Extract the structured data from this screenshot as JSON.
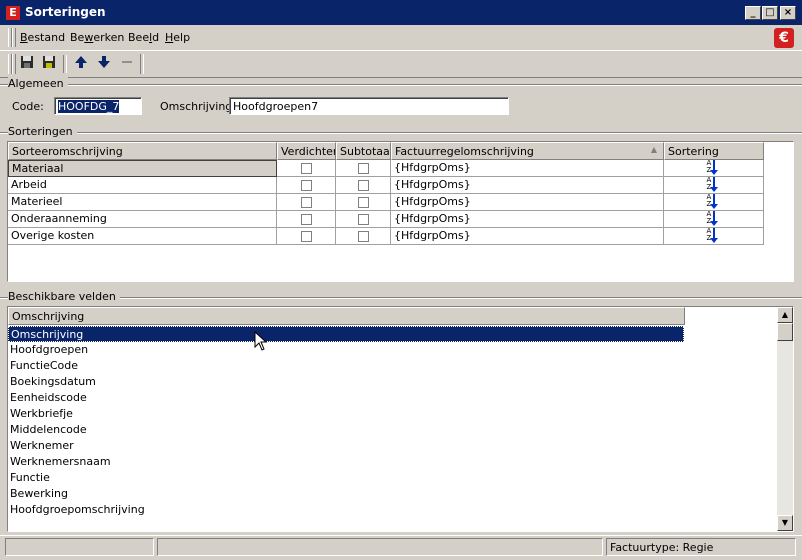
{
  "window": {
    "title": "Sorteringen",
    "min_icon": "minimize-icon",
    "max_icon": "maximize-icon",
    "close_icon": "close-icon"
  },
  "menu": [
    {
      "label": "Bestand",
      "accel": "B"
    },
    {
      "label": "Bewerken",
      "accel": "w"
    },
    {
      "label": "Beeld",
      "accel": "l"
    },
    {
      "label": "Help",
      "accel": "H"
    }
  ],
  "toolbar": {
    "icons": [
      "save-icon",
      "save-all-icon",
      "arrow-up-icon",
      "arrow-down-icon",
      "minus-icon"
    ]
  },
  "algemeen": {
    "label": "Algemeen",
    "code_label": "Code:",
    "code_value": "HOOFDG_7",
    "omschrijving_label": "Omschrijving:",
    "omschrijving_value": "Hoofdgroepen7"
  },
  "sorteringen": {
    "label": "Sorteringen",
    "columns": [
      "Sorteeromschrijving",
      "Verdichten",
      "Subtotaal",
      "Factuurregelomschrijving",
      "Sortering"
    ],
    "rows": [
      {
        "name": "Materiaal",
        "verdichten": false,
        "subtotaal": false,
        "factuurregel": "{HfdgrpOms}",
        "sort": "A-Z"
      },
      {
        "name": "Arbeid",
        "verdichten": false,
        "subtotaal": false,
        "factuurregel": "{HfdgrpOms}",
        "sort": "A-Z"
      },
      {
        "name": "Materieel",
        "verdichten": false,
        "subtotaal": false,
        "factuurregel": "{HfdgrpOms}",
        "sort": "A-Z"
      },
      {
        "name": "Onderaanneming",
        "verdichten": false,
        "subtotaal": false,
        "factuurregel": "{HfdgrpOms}",
        "sort": "A-Z"
      },
      {
        "name": "Overige kosten",
        "verdichten": false,
        "subtotaal": false,
        "factuurregel": "{HfdgrpOms}",
        "sort": "A-Z"
      }
    ]
  },
  "beschikbare": {
    "label": "Beschikbare velden",
    "column": "Omschrijving",
    "items": [
      "Omschrijving",
      "Hoofdgroepen",
      "FunctieCode",
      "Boekingsdatum",
      "Eenheidscode",
      "Werkbriefje",
      "Middelencode",
      "Werknemer",
      "Werknemersnaam",
      "Functie",
      "Bewerking",
      "Hoofdgroepomschrijving"
    ],
    "selected_index": 0
  },
  "statusbar": {
    "panel3": "Factuurtype: Regie"
  }
}
